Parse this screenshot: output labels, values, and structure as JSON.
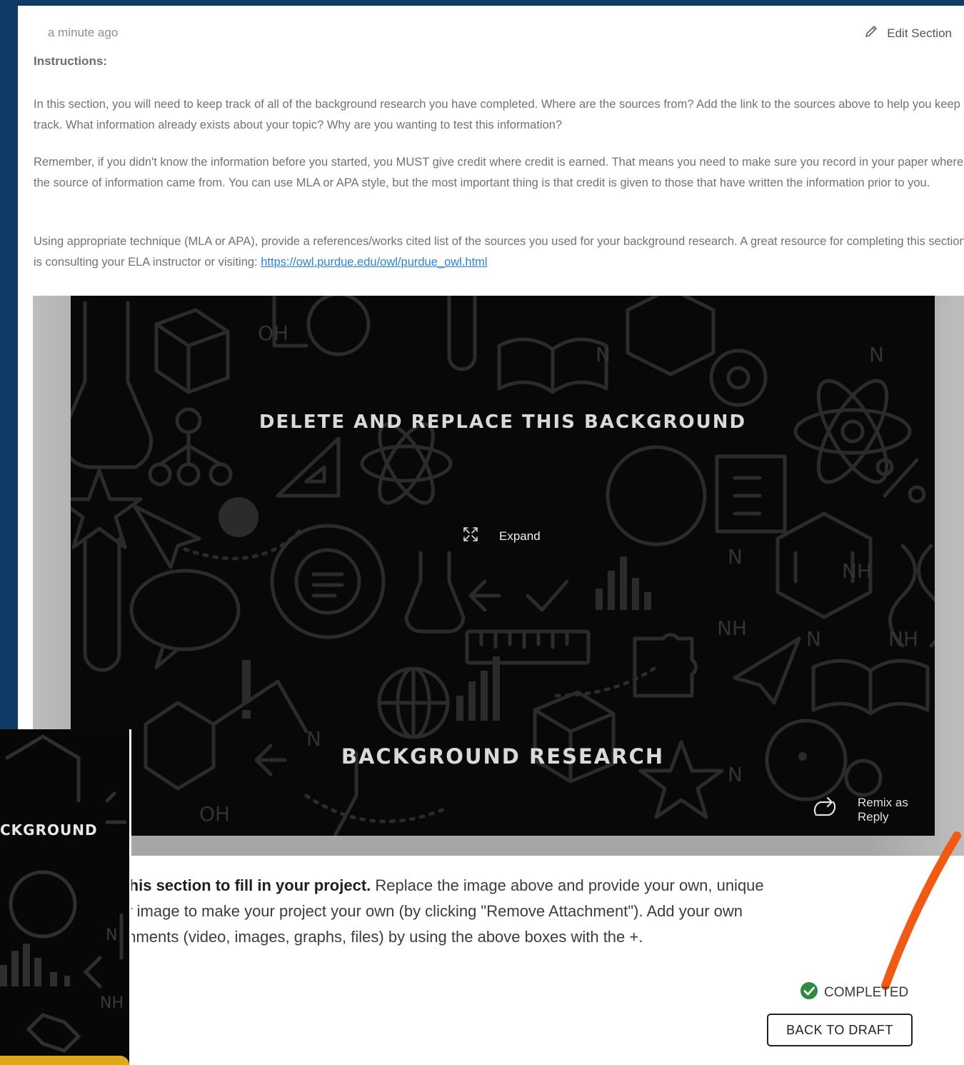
{
  "header": {
    "timestamp": "a minute ago",
    "edit_label": "Edit Section"
  },
  "instructions": {
    "label": "Instructions:",
    "p1": "In this section, you will need to keep track of all of the background research you have completed. Where are the sources from? Add the link to the sources above to help you keep track. What information already exists about your topic? Why are you wanting to test this information?",
    "p2": "Remember, if you didn't know the information before you started, you MUST give credit where credit is earned. That means you need to make sure you record in your paper where the source of information came from. You can use MLA or APA style, but the most important thing is that credit is given to those that have written the information prior to you.",
    "p3_text": "Using appropriate technique (MLA or APA), provide a references/works cited list of the sources you used for your background research. A great resource for completing this section is consulting your ELA instructor or visiting: ",
    "p3_link": "https://owl.purdue.edu/owl/purdue_owl.html"
  },
  "media": {
    "title_top": "DELETE AND REPLACE THIS BACKGROUND",
    "title_bottom": "BACKGROUND RESEARCH",
    "expand_label": "Expand",
    "remix_label": "Remix as Reply",
    "chem_labels": [
      "OH",
      "N",
      "N",
      "NH",
      "NH",
      "N",
      "NH",
      "N",
      "OH",
      "N",
      "N"
    ]
  },
  "help": {
    "bold": "e this section to fill in your project.",
    "line1_rest": " Replace the image above and provide your own, unique",
    "line2": "ver image to make your project your own (by clicking \"Remove Attachment\"). Add your own",
    "line3": "achments (video, images, graphs, files) by using the above boxes with the +."
  },
  "status": {
    "label": "COMPLETED",
    "icon": "check-circle-icon",
    "color": "#2e8b3d"
  },
  "actions": {
    "back_to_draft": "BACK TO DRAFT"
  },
  "thumbnail": {
    "label": "CKGROUND"
  },
  "colors": {
    "frame": "#0f3a66",
    "arrow": "#f05a14",
    "accent_gold": "#e0a61c"
  }
}
